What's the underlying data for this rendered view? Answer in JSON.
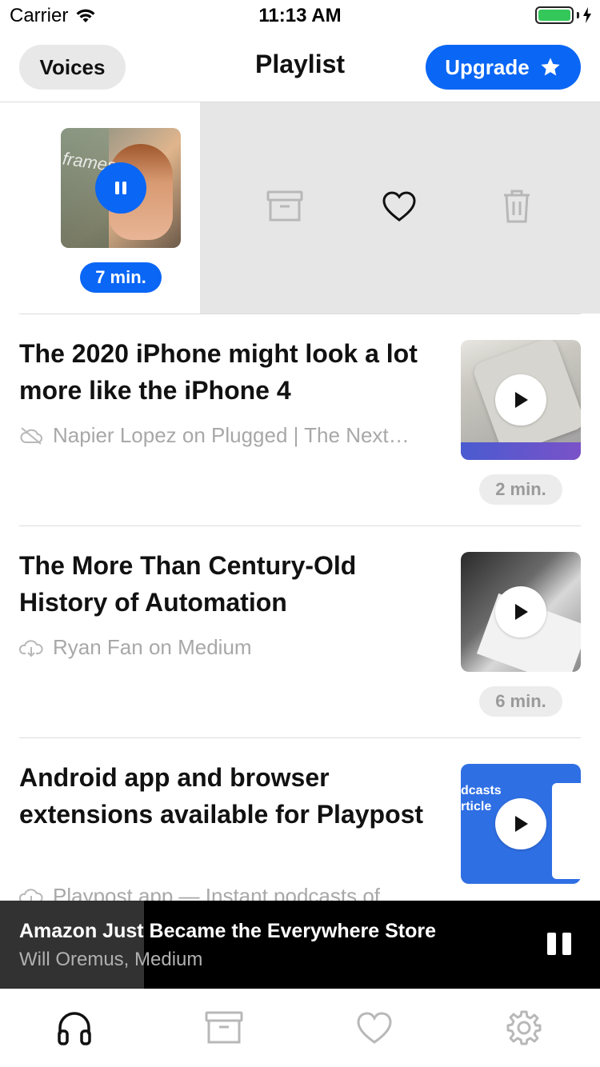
{
  "status_bar": {
    "carrier": "Carrier",
    "time": "11:13 AM",
    "battery_level": 1.0,
    "battery_color": "#34c759"
  },
  "header": {
    "left_button": "Voices",
    "title": "Playlist",
    "upgrade_button": "Upgrade",
    "upgrade_icon": "star-icon",
    "accent_color": "#0a66f5"
  },
  "active_item": {
    "thumbnail_text": "frames",
    "duration": "7 min.",
    "state_icon": "pause-icon",
    "swipe_actions": [
      {
        "name": "archive",
        "icon": "archive-icon"
      },
      {
        "name": "like",
        "icon": "heart-icon"
      },
      {
        "name": "delete",
        "icon": "trash-icon"
      }
    ]
  },
  "articles": [
    {
      "title": "The 2020 iPhone might look a lot more like the iPhone 4",
      "source": "Napier Lopez on Plugged | The Next…",
      "source_icon": "cloud-off-icon",
      "duration": "2 min."
    },
    {
      "title": "The More Than Century-Old History of Automation",
      "source": "Ryan Fan on Medium",
      "source_icon": "cloud-download-icon",
      "duration": "6 min."
    },
    {
      "title": "Android app and browser extensions available for Playpost",
      "source": "Playpost app — Instant podcasts of",
      "source_icon": "cloud-download-icon",
      "thumbnail_text": "dcasts\nrticle",
      "duration": ""
    }
  ],
  "now_playing": {
    "title": "Amazon Just Became the Everywhere Store",
    "subtitle": "Will Oremus, Medium",
    "progress": 0.24
  },
  "tab_bar": {
    "tabs": [
      {
        "name": "listen",
        "icon": "headphones-icon",
        "active": true
      },
      {
        "name": "archive",
        "icon": "archive-icon",
        "active": false
      },
      {
        "name": "favorites",
        "icon": "heart-icon",
        "active": false
      },
      {
        "name": "settings",
        "icon": "gear-icon",
        "active": false
      }
    ]
  }
}
